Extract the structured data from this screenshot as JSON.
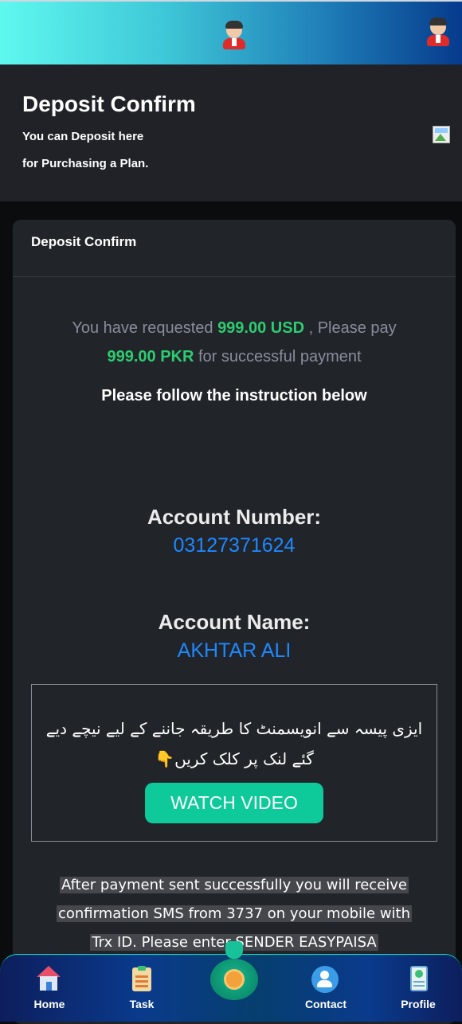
{
  "header": {
    "avatar_left_icon": "user-avatar-icon",
    "avatar_right_icon": "user-avatar-icon"
  },
  "hero": {
    "title": "Deposit Confirm",
    "subtitle_line1": "You can Deposit here",
    "subtitle_line2": "for Purchasing a Plan.",
    "image_icon": "broken-image-icon"
  },
  "card": {
    "header": "Deposit Confirm",
    "request_prefix": "You have requested",
    "request_amount": "999.00 USD",
    "request_middle": ", Please pay",
    "pay_amount": "999.00 PKR",
    "request_suffix": "for successful payment",
    "instruction": "Please follow the instruction below",
    "account_number_label": "Account Number:",
    "account_number": "03127371624",
    "account_name_label": "Account Name:",
    "account_name": "AKHTAR ALI",
    "urdu_text": "ایزی پیسہ سے انویسمنٹ کا طریقہ جاننے کے لیے نیچے دیے گئے لنک پر کلک کریں👇",
    "watch_video": "WATCH VIDEO",
    "note_line1": "After payment sent successfully you will receive",
    "note_line2": "confirmation SMS from 3737 on your mobile with",
    "note_line3": "Trx ID. Please enter SENDER EASYPAISA"
  },
  "colors": {
    "accent_green": "#2ecc71",
    "link_blue": "#1e88ff",
    "button_teal": "#0ec99a"
  },
  "nav": {
    "items": [
      {
        "label": "Home",
        "icon": "home-icon"
      },
      {
        "label": "Task",
        "icon": "task-icon"
      },
      {
        "label": "",
        "icon": "money-bag-icon"
      },
      {
        "label": "Contact",
        "icon": "contact-icon"
      },
      {
        "label": "Profile",
        "icon": "profile-icon"
      }
    ]
  }
}
